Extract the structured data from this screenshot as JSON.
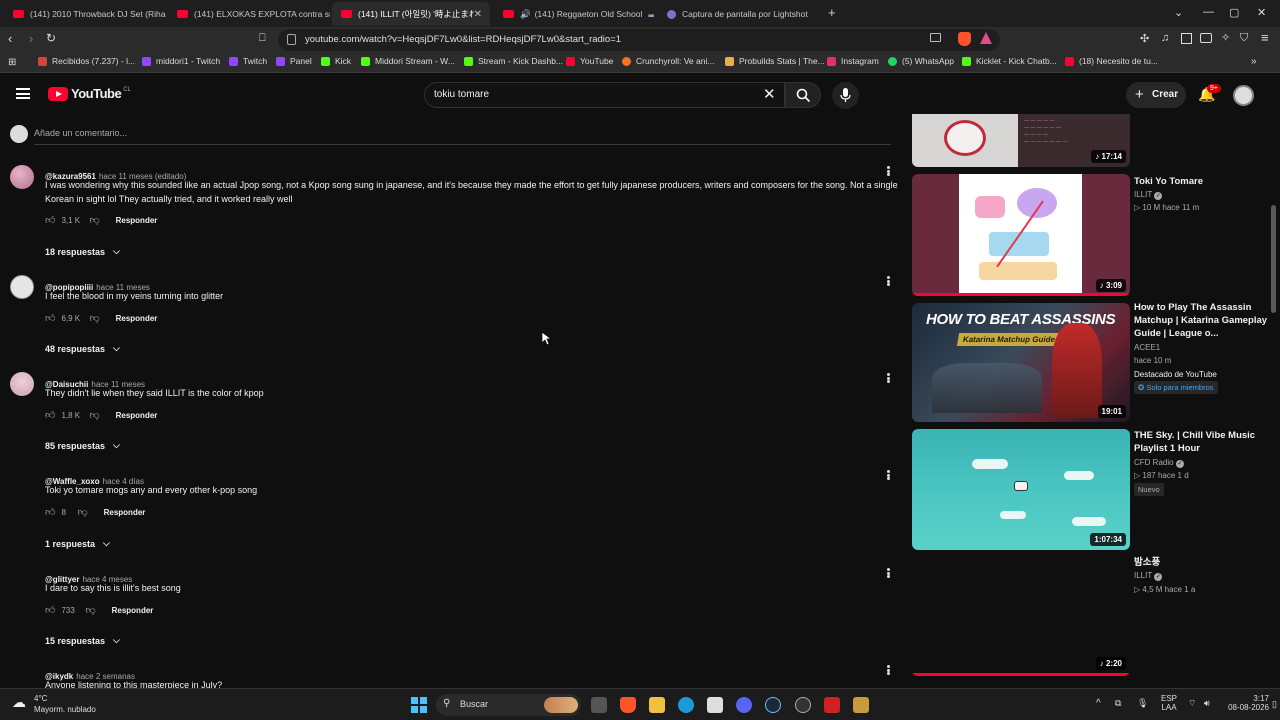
{
  "browser": {
    "tabs": [
      {
        "label": "(141) 2010 Throwback DJ Set (Rihann",
        "active": false
      },
      {
        "label": "(141) ELXOKAS EXPLOTA contra su E",
        "active": false
      },
      {
        "label": "(141) ILLIT (아일릿) '時よ止まれ (T",
        "active": true
      },
      {
        "label": "(141) Reggaeton Old School",
        "active": false
      },
      {
        "label": "Captura de pantalla por Lightshot",
        "active": false
      }
    ],
    "new_tab": "+",
    "url": "youtube.com/watch?v=HeqsjDF7Lw0&list=RDHeqsjDF7Lw0&start_radio=1",
    "bookmarks": [
      {
        "label": "Recibidos (7.237) - l...",
        "color": "#d44638"
      },
      {
        "label": "middori1 - Twitch",
        "color": "#9146ff"
      },
      {
        "label": "Twitch",
        "color": "#9146ff"
      },
      {
        "label": "Panel",
        "color": "#9146ff"
      },
      {
        "label": "Kick",
        "color": "#53fc18"
      },
      {
        "label": "Middori Stream - W...",
        "color": "#53fc18"
      },
      {
        "label": "Stream - Kick Dashb...",
        "color": "#53fc18"
      },
      {
        "label": "YouTube",
        "color": "#ff0033"
      },
      {
        "label": "Crunchyroll: Ve ani...",
        "color": "#f47521"
      },
      {
        "label": "Probuilds Stats | The...",
        "color": "#e8b04a"
      },
      {
        "label": "Instagram",
        "color": "#e1306c"
      },
      {
        "label": "(5) WhatsApp",
        "color": "#25d366"
      },
      {
        "label": "Kicklet - Kick Chatb...",
        "color": "#53fc18"
      },
      {
        "label": "(18) Necesito de tu...",
        "color": "#ff0033"
      }
    ]
  },
  "youtube": {
    "logo": "YouTube",
    "country": "CL",
    "search_query": "tokiu tomare",
    "create_label": "Crear",
    "notifications": "9+",
    "comment_placeholder": "Añade un comentario..."
  },
  "comments": [
    {
      "author": "@kazura9561",
      "time": "hace 11 meses (editado)",
      "text": "I was wondering why this sounded like an actual Jpop song, not a Kpop song sung in japanese, and it's because they made the effort to get fully japanese producers, writers and composers for the song. Not a single Korean in sight lol They actually tried, and it worked really well",
      "likes": "3,1 K",
      "reply": "Responder",
      "replies": "18 respuestas"
    },
    {
      "author": "@popipopiiii",
      "time": "hace 11 meses",
      "text": "I feel the blood in my veins turning into glitter",
      "likes": "6,9 K",
      "reply": "Responder",
      "replies": "48 respuestas"
    },
    {
      "author": "@Daisuchii",
      "time": "hace 11 meses",
      "text": "They didn't lie when they said ILLIT is the color of kpop",
      "likes": "1,8 K",
      "reply": "Responder",
      "replies": "85 respuestas"
    },
    {
      "author": "@Waffle_xoxo",
      "time": "hace 4 días",
      "text": "Toki yo tomare mogs any and every other k-pop song",
      "likes": "8",
      "reply": "Responder",
      "replies": "1 respuesta"
    },
    {
      "author": "@glittyer",
      "time": "hace 4 meses",
      "text": "I dare to say this is illit's best song",
      "likes": "733",
      "reply": "Responder",
      "replies": "15 respuestas"
    },
    {
      "author": "@ikydk",
      "time": "hace 2 semanas",
      "text": "Anyone listening to this masterpiece in July?"
    }
  ],
  "sidebar": [
    {
      "duration": "17:14"
    },
    {
      "title": "Toki Yo Tomare",
      "channel": "ILLIT",
      "meta": "10 M  hace 11 m",
      "duration": "3:09"
    },
    {
      "title": "How to Play The Assassin Matchup | Katarina Gameplay Guide | League o...",
      "channel": "ACEE1",
      "meta": "hace 10 m",
      "featured": "Destacado de YouTube",
      "members": "Solo para miembros",
      "duration": "19:01",
      "overlay_title": "HOW TO BEAT ASSASSINS",
      "overlay_sub": "Katarina Matchup Guide"
    },
    {
      "title": "THE Sky. | Chill Vibe Music Playlist 1 Hour",
      "channel": "CFD Radio",
      "meta": "187  hace 1 d",
      "badge": "Nuevo",
      "duration": "1:07:34"
    },
    {
      "title": "밤소풍",
      "channel": "ILLIT",
      "meta": "4,5 M  hace 1 a",
      "duration": "2:20"
    }
  ],
  "taskbar": {
    "weather_temp": "4°C",
    "weather_desc": "Mayorm. nublado",
    "search_label": "Buscar",
    "lang": "ESP",
    "lang2": "LAA",
    "time": "3:17",
    "date": "08-08-2026"
  }
}
